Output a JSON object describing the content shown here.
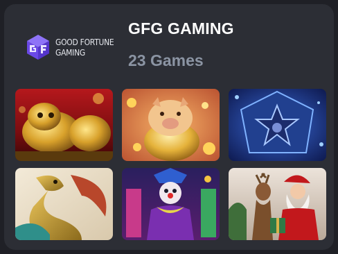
{
  "provider": {
    "logo_line1": "GOOD FORTUNE",
    "logo_line2": "GAMING",
    "name": "GFG GAMING",
    "game_count": "23 Games"
  },
  "games": [
    {
      "icon": "golden-dragon-statue-thumbnail"
    },
    {
      "icon": "golden-pig-thumbnail"
    },
    {
      "icon": "blue-star-gem-thumbnail"
    },
    {
      "icon": "green-gold-dragon-thumbnail"
    },
    {
      "icon": "clown-carnival-thumbnail"
    },
    {
      "icon": "santa-reindeer-thumbnail"
    }
  ],
  "colors": {
    "background": "#1f2026",
    "card": "#2c2e35",
    "title": "#ffffff",
    "subtitle": "#8b94a3",
    "logo_purple": "#7b5cf0"
  }
}
